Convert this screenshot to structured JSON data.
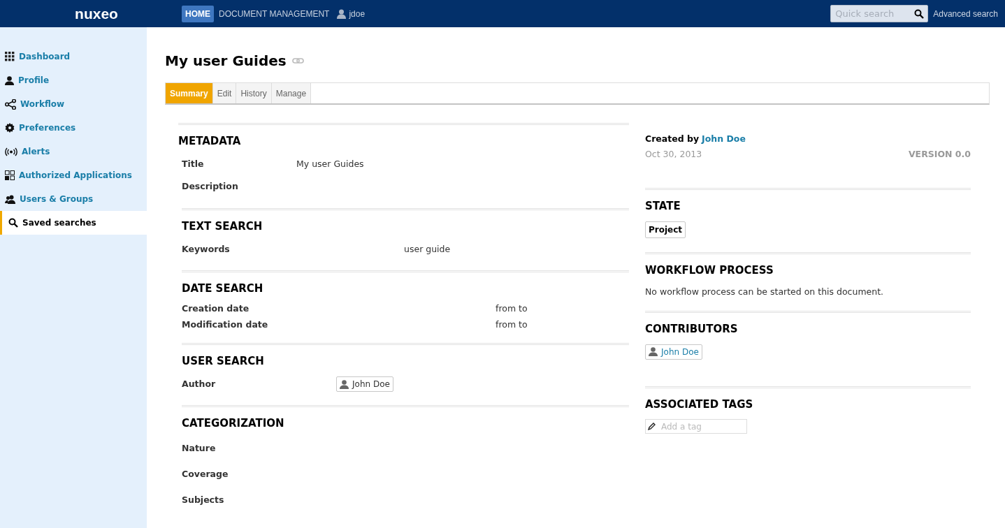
{
  "header": {
    "logo": "nuxeo",
    "nav": [
      {
        "label": "HOME",
        "selected": true
      },
      {
        "label": "DOCUMENT MANAGEMENT",
        "selected": false
      }
    ],
    "user": "jdoe",
    "search": {
      "placeholder": "Quick search"
    },
    "advanced_link": "Advanced search"
  },
  "sidebar": {
    "items": [
      {
        "label": "Dashboard",
        "selected": false
      },
      {
        "label": "Profile",
        "selected": false
      },
      {
        "label": "Workflow",
        "selected": false
      },
      {
        "label": "Preferences",
        "selected": false
      },
      {
        "label": "Alerts",
        "selected": false
      },
      {
        "label": "Authorized Applications",
        "selected": false
      },
      {
        "label": "Users & Groups",
        "selected": false
      },
      {
        "label": "Saved searches",
        "selected": true
      }
    ]
  },
  "document": {
    "title": "My user Guides",
    "tabs": [
      {
        "label": "Summary",
        "selected": true
      },
      {
        "label": "Edit",
        "selected": false
      },
      {
        "label": "History",
        "selected": false
      },
      {
        "label": "Manage",
        "selected": false
      }
    ],
    "sections": [
      {
        "title": "METADATA",
        "rows": [
          {
            "label": "Title",
            "kind": "text",
            "value": "My user Guides"
          },
          {
            "label": "Description",
            "kind": "empty"
          }
        ]
      },
      {
        "title": "TEXT SEARCH",
        "rows": [
          {
            "label": "Keywords",
            "kind": "text",
            "value": "user guide"
          }
        ]
      },
      {
        "title": "DATE SEARCH",
        "rows": [
          {
            "label": "Creation date",
            "kind": "text",
            "value": "from to"
          },
          {
            "label": "Modification date",
            "kind": "text",
            "value": "from to"
          }
        ]
      },
      {
        "title": "USER SEARCH",
        "rows": [
          {
            "label": "Author",
            "kind": "user",
            "value": "John Doe"
          }
        ]
      },
      {
        "title": "CATEGORIZATION",
        "rows": [
          {
            "label": "Nature",
            "kind": "empty"
          },
          {
            "label": "Coverage",
            "kind": "empty"
          },
          {
            "label": "Subjects",
            "kind": "empty"
          }
        ]
      }
    ],
    "info": {
      "created_by_label": "Created by",
      "author": "John Doe",
      "date": "Oct 30, 2013",
      "version": "VERSION 0.0"
    },
    "state": {
      "title": "STATE",
      "value": "Project"
    },
    "workflow": {
      "title": "WORKFLOW PROCESS",
      "message": "No workflow process can be started on this document."
    },
    "contributors": {
      "title": "CONTRIBUTORS",
      "users": [
        "John Doe"
      ]
    },
    "tags": {
      "title": "ASSOCIATED TAGS",
      "placeholder": "Add a tag"
    }
  }
}
